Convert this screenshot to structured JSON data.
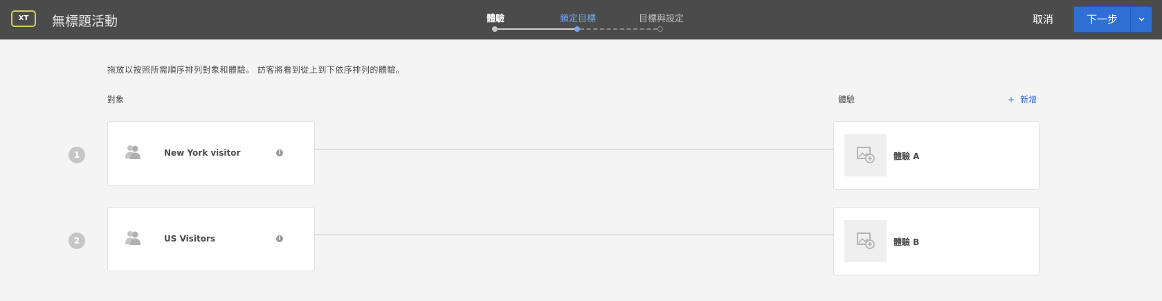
{
  "header": {
    "badge": "XT",
    "title": "無標題活動",
    "steps": [
      {
        "label": "體驗",
        "state": "completed"
      },
      {
        "label": "鎖定目標",
        "state": "current"
      },
      {
        "label": "目標與設定",
        "state": "upcoming"
      }
    ],
    "cancel_label": "取消",
    "next_label": "下一步",
    "next_caret_icon": "chevron-down-icon"
  },
  "main": {
    "instructions": "拖放以按照所需順序排列對象和體驗。 訪客將看到從上到下依序排列的體驗。",
    "audience_header": "對象",
    "experience_header": "體驗",
    "add_icon": "+",
    "add_label": "新增",
    "rows": [
      {
        "number": "1",
        "audience": "New York visitor",
        "experience": "體驗 A"
      },
      {
        "number": "2",
        "audience": "US Visitors",
        "experience": "體驗 B"
      }
    ]
  },
  "colors": {
    "header_bg": "#4b4b4b",
    "accent": "#2e6fd3",
    "current_step": "#75a6e7",
    "badge_border": "#d4d066",
    "page_bg": "#f4f4f4"
  }
}
